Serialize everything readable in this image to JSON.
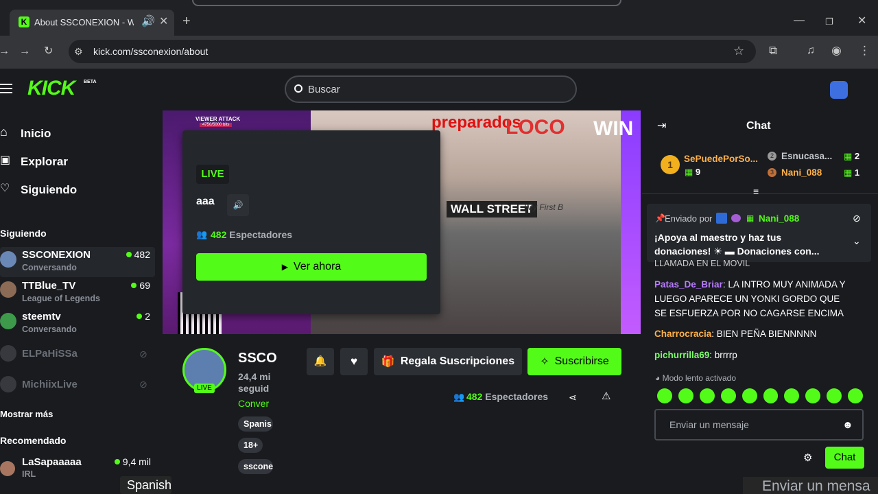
{
  "browser": {
    "tab_title": "About SSCONEXION - Watc",
    "url": "kick.com/ssconexion/about"
  },
  "header": {
    "logo": "KICK",
    "beta": "BETA",
    "search_placeholder": "Buscar"
  },
  "sidebar": {
    "nav": [
      {
        "label": "Inicio"
      },
      {
        "label": "Explorar"
      },
      {
        "label": "Siguiendo"
      }
    ],
    "following_title": "Siguiendo",
    "following": [
      {
        "name": "SSCONEXION",
        "category": "Conversando",
        "viewers": "482",
        "live": true
      },
      {
        "name": "TTBlue_TV",
        "category": "League of Legends",
        "viewers": "69",
        "live": true
      },
      {
        "name": "steemtv",
        "category": "Conversando",
        "viewers": "2",
        "live": true
      },
      {
        "name": "ELPaHiSSa",
        "category": "",
        "viewers": "",
        "live": false
      },
      {
        "name": "MichiixLive",
        "category": "",
        "viewers": "",
        "live": false
      }
    ],
    "show_more": "Mostrar más",
    "recommended_title": "Recomendado",
    "recommended": [
      {
        "name": "LaSapaaaaa",
        "category": "IRL",
        "viewers": "9,4 mil"
      }
    ],
    "bottom_overlay": "Spanish"
  },
  "video": {
    "overlay_texts": {
      "viewer_attack": "VIEWER ATTACK",
      "viewer_progress": "4750/5000 bits",
      "preparado": "preparados",
      "loco": "LOCO",
      "win": "WIN",
      "wall_street": "WALL STREET",
      "first": "My First B"
    }
  },
  "popup": {
    "live": "LIVE",
    "title": "aaa",
    "viewers_count": "482",
    "viewers_label": "Espectadores",
    "watch_button": "Ver ahora"
  },
  "channel": {
    "name": "SSCO",
    "followers_line1": "24,4 mi",
    "followers_line2": "seguid",
    "category": "Conver",
    "live_badge": "LIVE",
    "tags": [
      "Spanis",
      "18+",
      "sscone"
    ],
    "gift_button": "Regala Suscripciones",
    "subscribe_button": "Suscribirse",
    "viewers_count": "482",
    "viewers_label": "Espectadores"
  },
  "chat": {
    "title": "Chat",
    "leaderboard": [
      {
        "rank": "1",
        "name": "SePuedePorSo...",
        "count": "9"
      },
      {
        "rank": "2",
        "name": "Esnucasa...",
        "count": "2"
      },
      {
        "rank": "3",
        "name": "Nani_088",
        "count": "1"
      }
    ],
    "pinned": {
      "sent_by": "Enviado por",
      "user": "Nani_088",
      "text": "¡Apoya al maestro y haz tus donaciones! ☀ ▬ Donaciones con..."
    },
    "messages": [
      {
        "user": "",
        "text": "LLAMADA EN EL MOVIL",
        "color": "#ffffff"
      },
      {
        "user": "Patas_De_Briar",
        "text": ": LA INTRO MUY ANIMADA Y LUEGO APARECE UN YONKI GORDO QUE SE ESFUERZA POR NO CAGARSE ENCIMA",
        "color": "#b97cff"
      },
      {
        "user": "Charrocracia",
        "text": ": BIEN PEÑA BIENNNNN",
        "color": "#ffb14a"
      },
      {
        "user": "pichurrilla69",
        "text": ": brrrrp",
        "color": "#7dff6b"
      }
    ],
    "slow_mode": "Modo lento activado",
    "input_placeholder": "Enviar un mensaje",
    "send_button": "Chat",
    "bottom_overlay": "Enviar un mensa"
  },
  "colors": {
    "accent": "#53fc18",
    "bg": "#191b1f"
  }
}
